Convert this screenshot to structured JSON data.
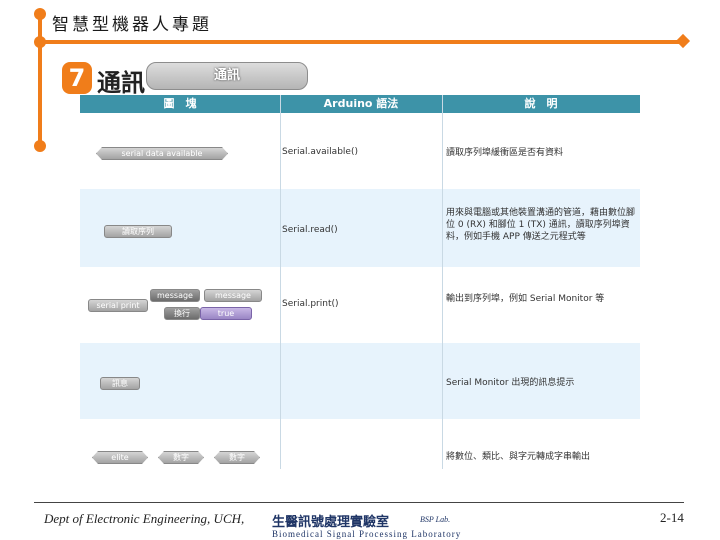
{
  "header": {
    "title": "智慧型機器人專題"
  },
  "section": {
    "number": "7",
    "title": "通訊",
    "category_block": "通訊",
    "accent_color": "#f07d1a"
  },
  "table": {
    "header_color": "#3d93a8",
    "columns": [
      "圖　塊",
      "Arduino 語法",
      "說　明"
    ],
    "rows": [
      {
        "blocks": [
          "serial data available"
        ],
        "code": "Serial.available()",
        "description": "讀取序列埠緩衝區是否有資料"
      },
      {
        "blocks": [
          "讀取序列"
        ],
        "code": "Serial.read()",
        "description": "用來與電腦或其他裝置溝通的管道，藉由數位腳位 0 (RX) 和腳位 1 (TX) 通訊，讀取序列埠資料，例如手機 APP 傳送之元程式等"
      },
      {
        "blocks": [
          "message",
          "serial print",
          "message",
          "換行",
          "true"
        ],
        "code": "Serial.print()",
        "description": "輸出到序列埠，例如 Serial Monitor 等"
      },
      {
        "blocks": [
          "訊息"
        ],
        "code": "",
        "description": "Serial Monitor 出現的訊息提示"
      },
      {
        "blocks": [
          "elite",
          "數字",
          "數字"
        ],
        "code": "",
        "description": "將數位、類比、與字元轉成字串輸出"
      }
    ]
  },
  "footer": {
    "dept": "Dept of Electronic Engineering, UCH,",
    "lab_name": "生醫訊號處理實驗室",
    "lab_abbr": "BSP Lab.",
    "lab_english": "Biomedical Signal Processing Laboratory",
    "page": "2-14"
  }
}
